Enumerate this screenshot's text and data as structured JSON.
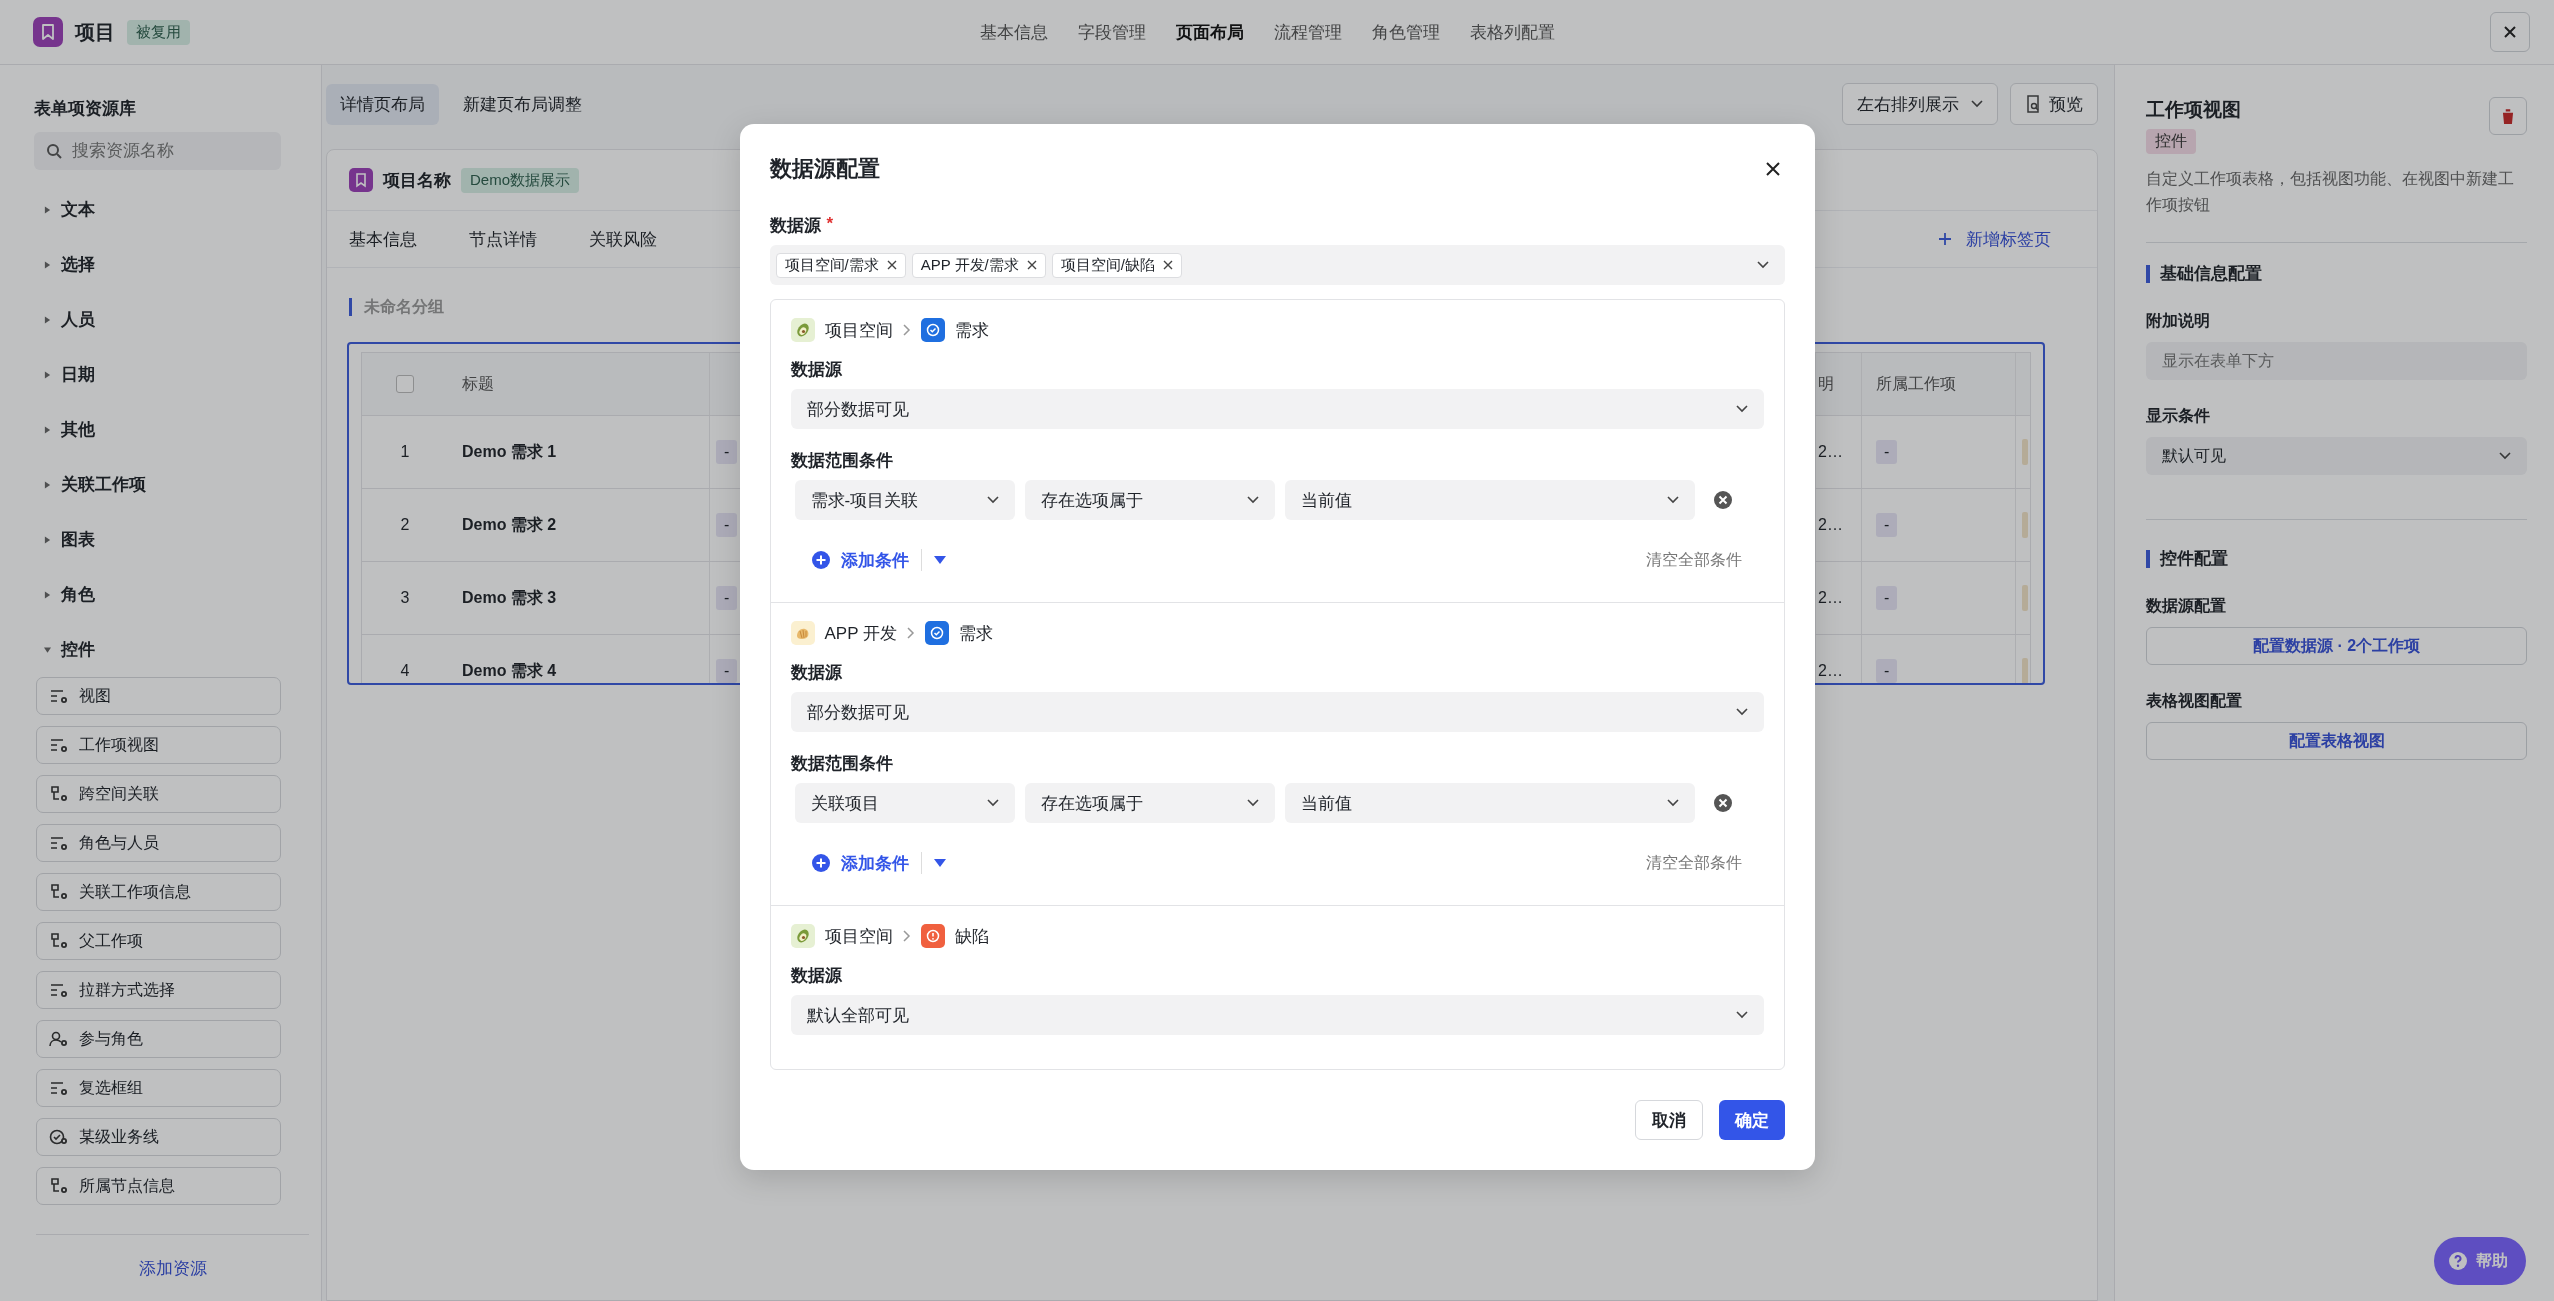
{
  "top_bar": {
    "title": "项目",
    "badge": "被复用",
    "tabs": [
      {
        "label": "基本信息",
        "selected": false
      },
      {
        "label": "字段管理",
        "selected": false
      },
      {
        "label": "页面布局",
        "selected": true
      },
      {
        "label": "流程管理",
        "selected": false
      },
      {
        "label": "角色管理",
        "selected": false
      },
      {
        "label": "表格列配置",
        "selected": false
      }
    ]
  },
  "sidebar": {
    "title": "表单项资源库",
    "search": {
      "placeholder": "搜索资源名称"
    },
    "categories": [
      {
        "label": "文本",
        "expanded": false
      },
      {
        "label": "选择",
        "expanded": false
      },
      {
        "label": "人员",
        "expanded": false
      },
      {
        "label": "日期",
        "expanded": false
      },
      {
        "label": "其他",
        "expanded": false
      },
      {
        "label": "关联工作项",
        "expanded": false
      },
      {
        "label": "图表",
        "expanded": false
      },
      {
        "label": "角色",
        "expanded": false
      },
      {
        "label": "控件",
        "expanded": true,
        "children": [
          {
            "label": "视图",
            "kind": "list"
          },
          {
            "label": "工作项视图",
            "kind": "list"
          },
          {
            "label": "跨空间关联",
            "kind": "branch"
          },
          {
            "label": "角色与人员",
            "kind": "list"
          },
          {
            "label": "关联工作项信息",
            "kind": "branch"
          },
          {
            "label": "父工作项",
            "kind": "branch"
          },
          {
            "label": "拉群方式选择",
            "kind": "list"
          },
          {
            "label": "参与角色",
            "kind": "person"
          },
          {
            "label": "复选框组",
            "kind": "list"
          },
          {
            "label": "某级业务线",
            "kind": "target"
          },
          {
            "label": "所属节点信息",
            "kind": "branch"
          }
        ]
      }
    ],
    "footer_button": "添加资源"
  },
  "layout_toolbar": {
    "tabs": [
      {
        "label": "详情页布局",
        "selected": true
      },
      {
        "label": "新建页布局调整",
        "selected": false
      }
    ],
    "arrangement": "左右排列展示",
    "preview_button": "预览"
  },
  "form_card": {
    "title": "项目名称",
    "badge": "Demo数据展示",
    "tabs": [
      "基本信息",
      "节点详情",
      "关联风险"
    ],
    "add_tab": "新增标签页",
    "group": "未命名分组",
    "table": {
      "header_checked": false,
      "columns": [
        "标题",
        "明",
        "所属工作项"
      ],
      "rows": [
        {
          "index": "1",
          "title": "Demo 需求 1",
          "cell_3": "-",
          "cell_4": "2…",
          "cell_5": "-"
        },
        {
          "index": "2",
          "title": "Demo 需求 2",
          "cell_3": "-",
          "cell_4": "2…",
          "cell_5": "-"
        },
        {
          "index": "3",
          "title": "Demo 需求 3",
          "cell_3": "-",
          "cell_4": "2…",
          "cell_5": "-"
        },
        {
          "index": "4",
          "title": "Demo 需求 4",
          "cell_3": "-",
          "cell_4": "2…",
          "cell_5": "-"
        }
      ]
    }
  },
  "right_panel": {
    "title": "工作项视图",
    "tag": "控件",
    "description": "自定义工作项表格，包括视图功能、在视图中新建工作项按钮",
    "sections": [
      {
        "title": "基础信息配置",
        "fields": [
          {
            "label": "附加说明",
            "kind": "input",
            "placeholder": "显示在表单下方"
          },
          {
            "label": "显示条件",
            "kind": "select",
            "value": "默认可见"
          }
        ]
      },
      {
        "title": "控件配置",
        "fields": [
          {
            "label": "数据源配置",
            "kind": "button",
            "value": "配置数据源 · 2个工作项"
          },
          {
            "label": "表格视图配置",
            "kind": "button",
            "value": "配置表格视图"
          }
        ]
      }
    ]
  },
  "help_button": "帮助",
  "dialog": {
    "title": "数据源配置",
    "field_label": "数据源",
    "required_mark": "*",
    "tags": [
      "项目空间/需求",
      "APP 开发/需求",
      "项目空间/缺陷"
    ],
    "sources": [
      {
        "space": {
          "label": "项目空间",
          "kind": "avocado"
        },
        "type": {
          "label": "需求",
          "kind": "requirement"
        },
        "label": "数据源",
        "value": "部分数据可见",
        "conditions_label": "数据范围条件",
        "conditions": [
          {
            "field": "需求-项目关联",
            "operator": "存在选项属于",
            "value": "当前值"
          }
        ],
        "add_condition": "添加条件",
        "clear_all": "清空全部条件"
      },
      {
        "space": {
          "label": "APP 开发",
          "kind": "shell"
        },
        "type": {
          "label": "需求",
          "kind": "requirement"
        },
        "label": "数据源",
        "value": "部分数据可见",
        "conditions_label": "数据范围条件",
        "conditions": [
          {
            "field": "关联项目",
            "operator": "存在选项属于",
            "value": "当前值"
          }
        ],
        "add_condition": "添加条件",
        "clear_all": "清空全部条件"
      },
      {
        "space": {
          "label": "项目空间",
          "kind": "avocado"
        },
        "type": {
          "label": "缺陷",
          "kind": "defect"
        },
        "label": "数据源",
        "value": "默认全部可见"
      }
    ],
    "cancel": "取消",
    "confirm": "确定"
  }
}
